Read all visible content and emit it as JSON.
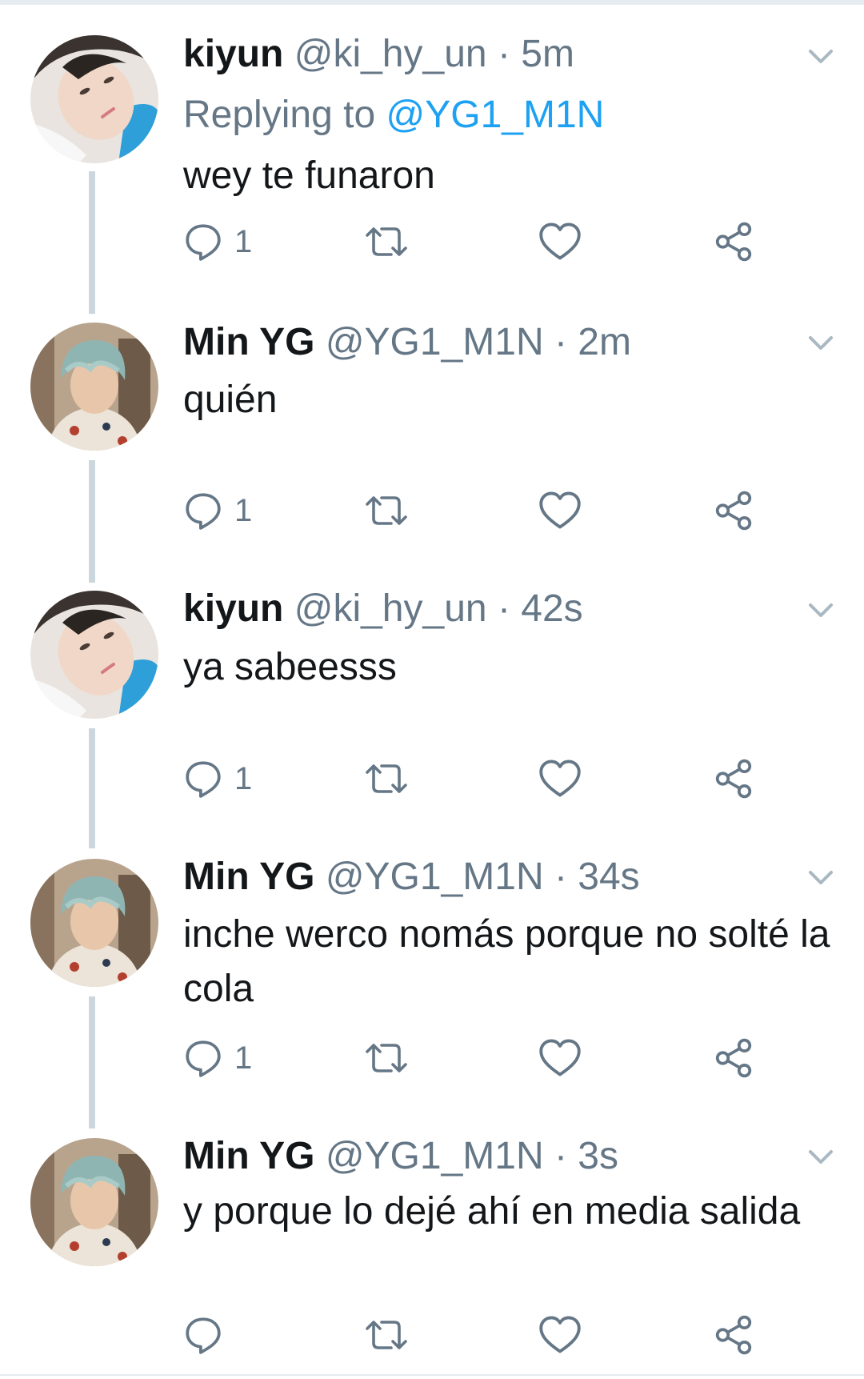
{
  "tweets": [
    {
      "display_name": "kiyun",
      "handle": "@ki_hy_un",
      "time": "· 5m",
      "replying_prefix": "Replying to",
      "replying_to": "@YG1_M1N",
      "text": "wey te funaron",
      "reply_count": "1",
      "avatar": "kiyun-avatar"
    },
    {
      "display_name": "Min YG",
      "handle": "@YG1_M1N",
      "time": "· 2m",
      "text": "quién",
      "reply_count": "1",
      "avatar": "minyg-avatar"
    },
    {
      "display_name": "kiyun",
      "handle": "@ki_hy_un",
      "time": "· 42s",
      "text": "ya sabeesss",
      "reply_count": "1",
      "avatar": "kiyun-avatar"
    },
    {
      "display_name": "Min YG",
      "handle": "@YG1_M1N",
      "time": "· 34s",
      "text": "inche werco nomás porque no solté la cola",
      "reply_count": "1",
      "avatar": "minyg-avatar"
    },
    {
      "display_name": "Min YG",
      "handle": "@YG1_M1N",
      "time": "· 3s",
      "text": "y porque lo dejé ahí en media salida",
      "reply_count": "",
      "avatar": "minyg-avatar"
    }
  ],
  "icons": {
    "reply": "reply-icon",
    "retweet": "retweet-icon",
    "like": "heart-icon",
    "share": "share-icon",
    "menu": "chevron-down-icon"
  },
  "colors": {
    "text": "#14171a",
    "secondary": "#657786",
    "link": "#1da1f2",
    "thread_line": "#ccd6dd"
  }
}
